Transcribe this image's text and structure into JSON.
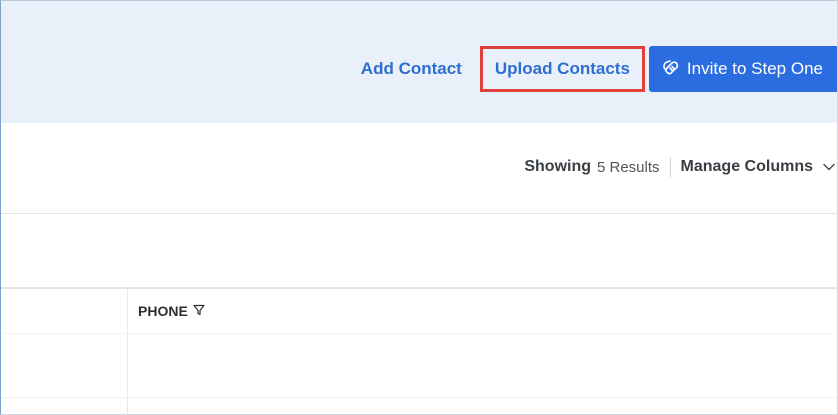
{
  "header": {
    "add_contact_label": "Add Contact",
    "upload_contacts_label": "Upload Contacts",
    "invite_label": "Invite to Step One",
    "invite_icon": "handshake-icon"
  },
  "toolbar": {
    "showing_label": "Showing",
    "results_text": "5 Results",
    "manage_columns_label": "Manage Columns",
    "manage_columns_icon": "chevron-down-icon"
  },
  "table": {
    "columns": [
      {
        "label": "PHONE",
        "icon": "filter-icon"
      }
    ],
    "rows": [
      {
        "phone": ""
      },
      {
        "phone": ""
      }
    ]
  },
  "colors": {
    "accent": "#2b6de0",
    "link": "#2d6fd0",
    "header_bg": "#eaf0f9",
    "highlight_border": "#e0403a"
  }
}
